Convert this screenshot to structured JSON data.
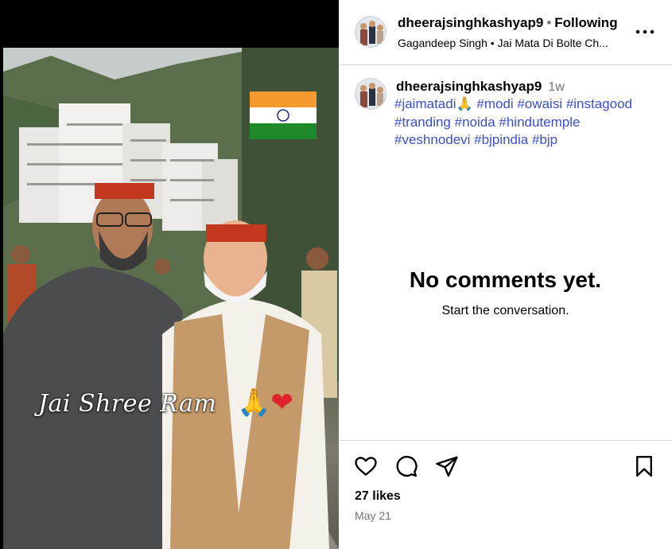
{
  "post": {
    "overlay_text": "Jai Shree Ram",
    "overlay_emoji": "🙏",
    "overlay_heart": "❤"
  },
  "header": {
    "username": "dheerajsinghkashyap9",
    "separator": "•",
    "follow_status": "Following",
    "audio_line": "Gagandeep Singh • Jai Mata Di Bolte Ch...",
    "more_icon": "more-horizontal-icon"
  },
  "caption": {
    "username": "dheerajsinghkashyap9",
    "time": "1w",
    "tags_line1": "#jaimatadi🙏 #modi #owaisi #instagood",
    "tags_line2": "#tranding #noida #hindutemple",
    "tags_line3": "#veshnodevi #bjpindia #bjp"
  },
  "comments": {
    "empty_title": "No comments yet.",
    "empty_subtitle": "Start the conversation."
  },
  "actions": {
    "like_icon": "heart-icon",
    "comment_icon": "comment-icon",
    "share_icon": "share-icon",
    "save_icon": "bookmark-icon",
    "likes": "27 likes",
    "date": "May 21"
  },
  "colors": {
    "hashtag": "#3a4fce",
    "muted": "#737373",
    "divider": "#dbdbdb"
  }
}
